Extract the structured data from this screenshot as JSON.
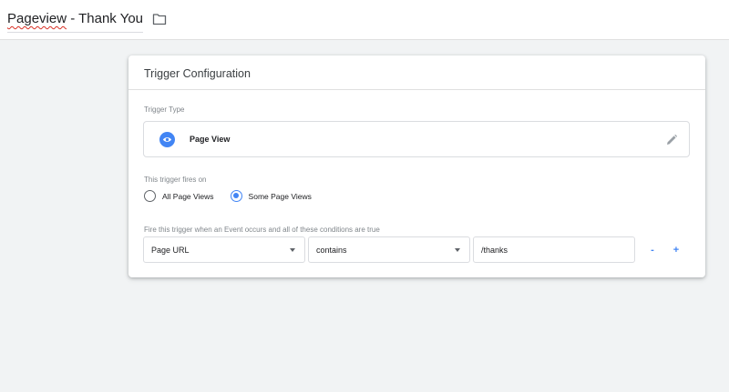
{
  "header": {
    "title_word1": "Pageview",
    "title_rest": " - Thank You",
    "folder_icon": "folder-icon"
  },
  "card": {
    "title": "Trigger Configuration",
    "trigger_type_label": "Trigger Type",
    "trigger_type": {
      "name": "Page View",
      "icon": "eye-icon",
      "edit_icon": "pencil-icon"
    },
    "fires_on_label": "This trigger fires on",
    "fires_on_options": [
      {
        "label": "All Page Views",
        "selected": false
      },
      {
        "label": "Some Page Views",
        "selected": true
      }
    ],
    "condition_label": "Fire this trigger when an Event occurs and all of these conditions are true",
    "condition": {
      "variable": "Page URL",
      "operator": "contains",
      "value": "/thanks",
      "remove_label": "-",
      "add_label": "+"
    }
  },
  "colors": {
    "accent": "#4285f4",
    "background": "#f1f3f4"
  }
}
